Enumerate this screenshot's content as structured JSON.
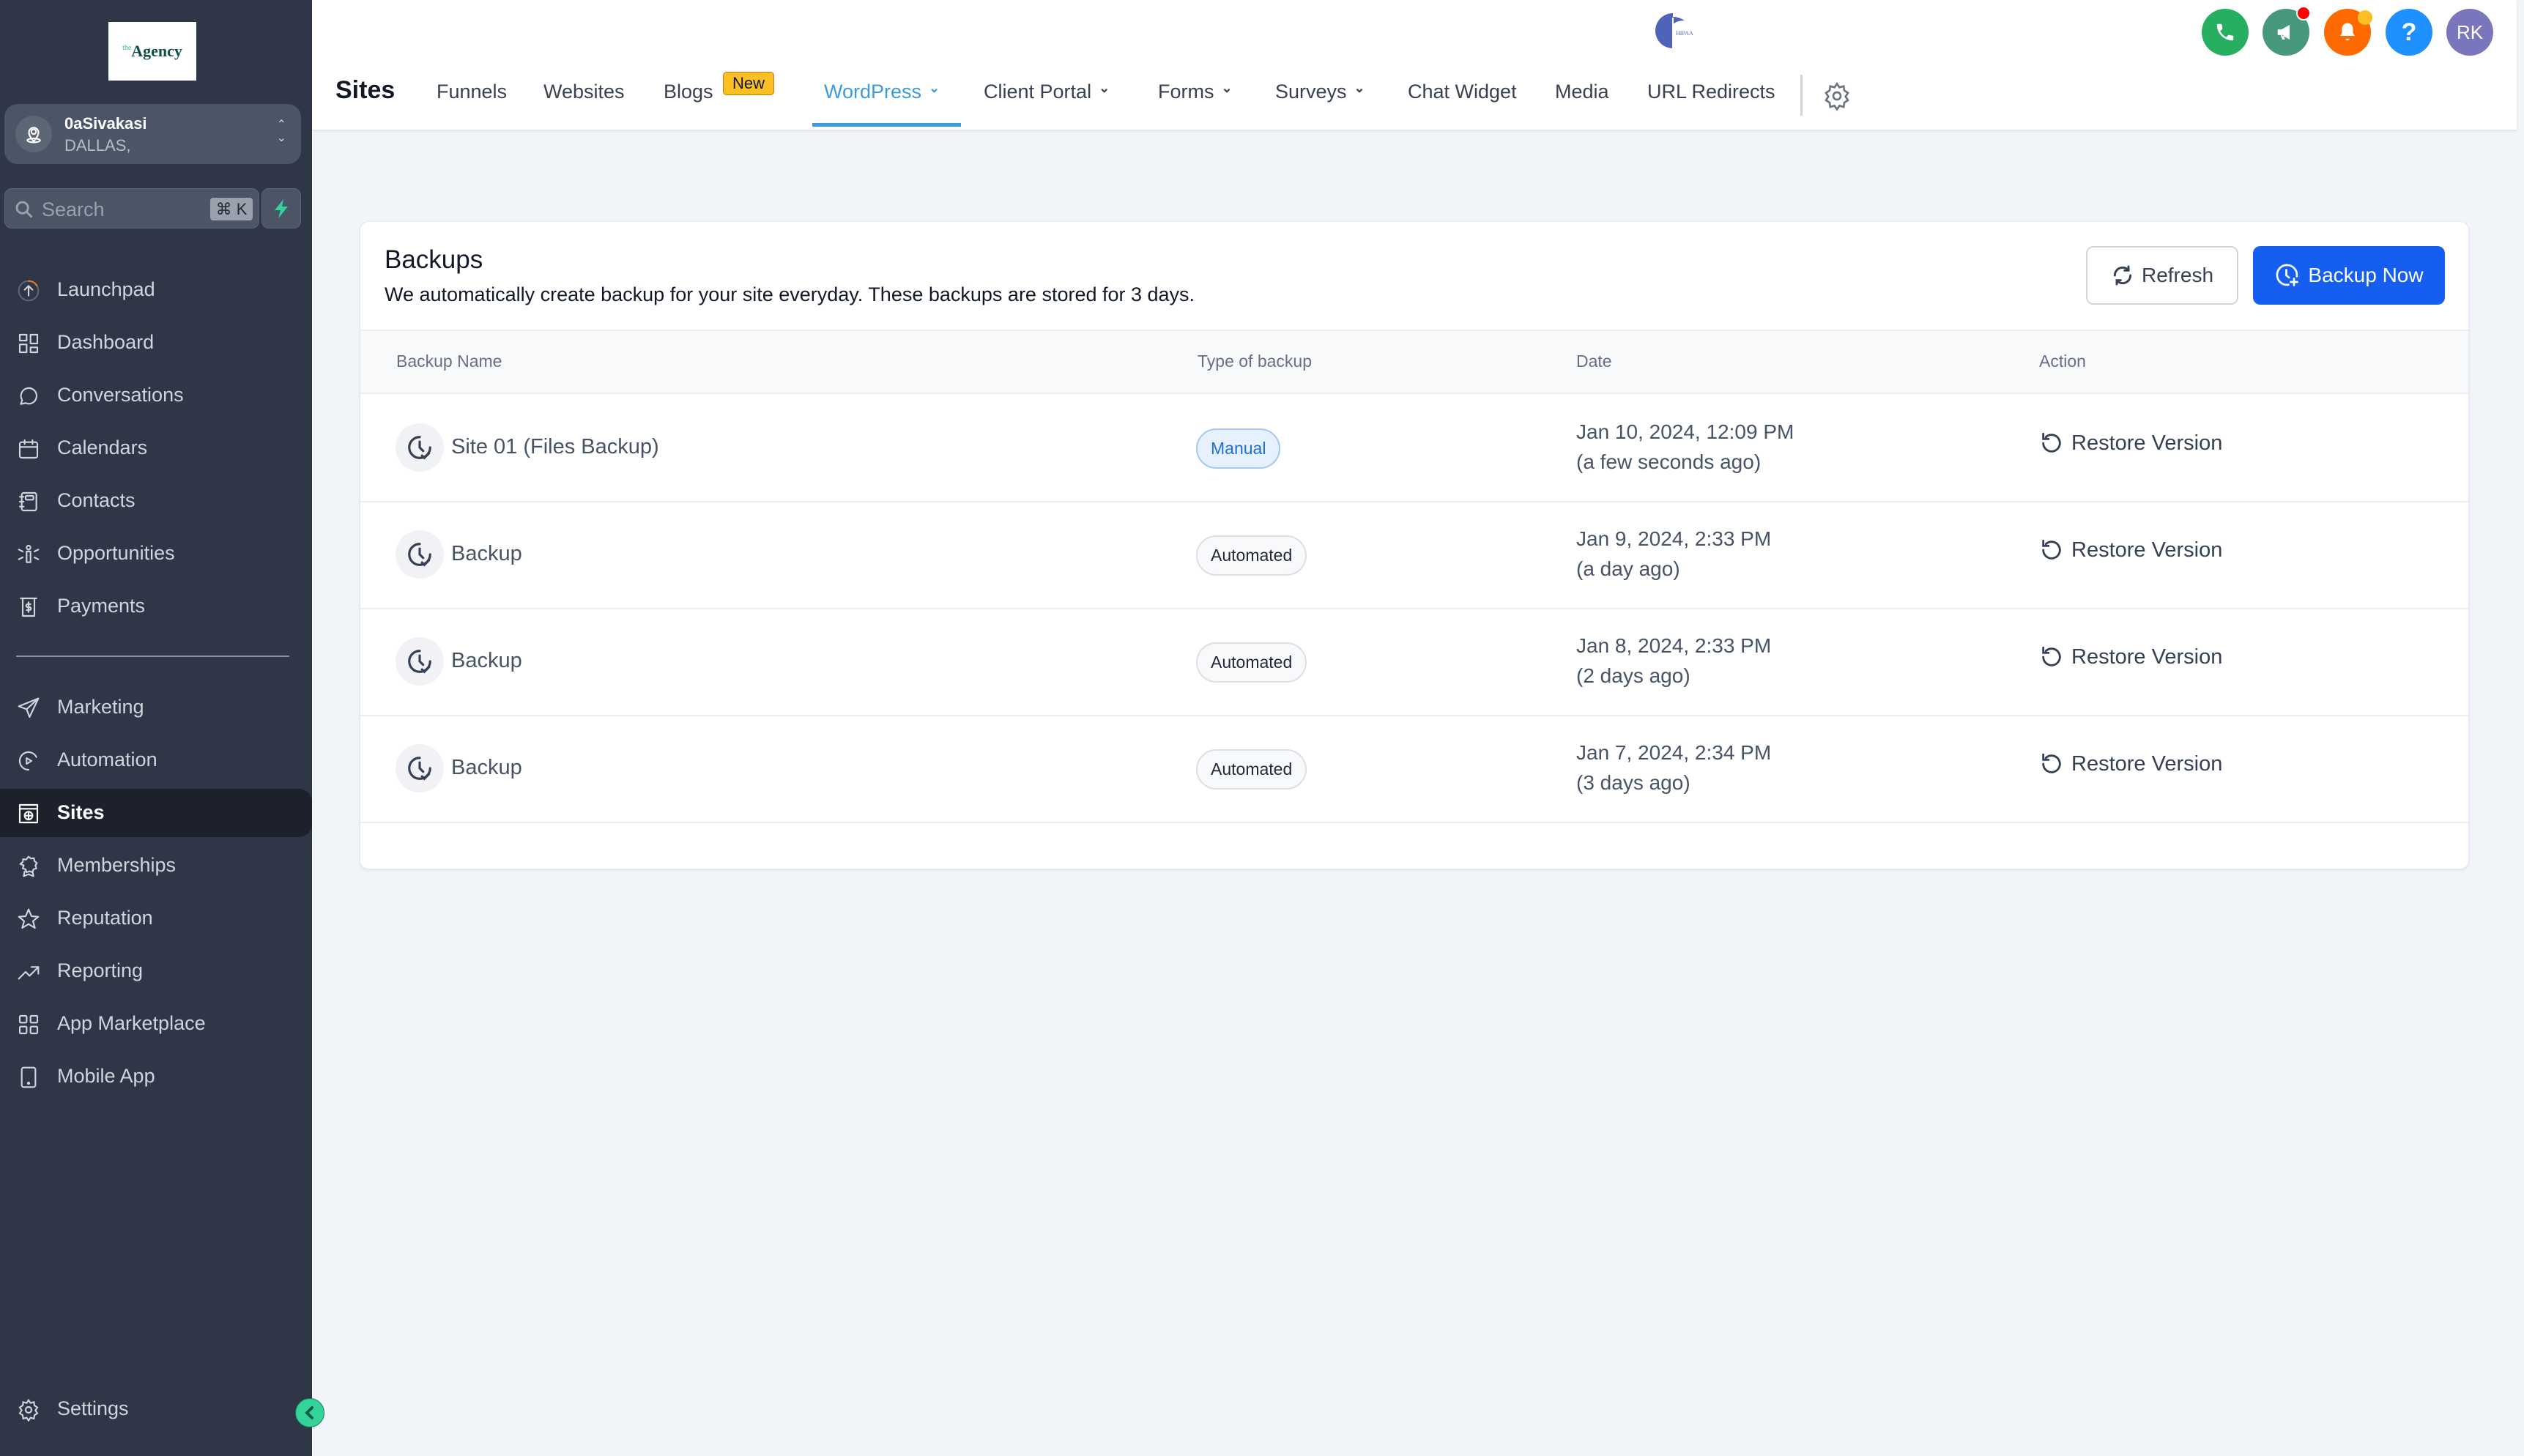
{
  "sidebar": {
    "logo": {
      "small": "the",
      "main": "Agency"
    },
    "location": {
      "name": "0aSivakasi",
      "sub": "DALLAS,"
    },
    "search": {
      "placeholder": "Search",
      "shortcut": "⌘ K"
    },
    "items": [
      {
        "label": "Launchpad",
        "icon": "launchpad-icon"
      },
      {
        "label": "Dashboard",
        "icon": "dashboard-icon"
      },
      {
        "label": "Conversations",
        "icon": "chat-bubble-icon"
      },
      {
        "label": "Calendars",
        "icon": "calendar-icon"
      },
      {
        "label": "Contacts",
        "icon": "contacts-book-icon"
      },
      {
        "label": "Opportunities",
        "icon": "opportunities-icon"
      },
      {
        "label": "Payments",
        "icon": "payments-icon"
      },
      {
        "label": "Marketing",
        "icon": "paper-plane-icon"
      },
      {
        "label": "Automation",
        "icon": "automation-play-icon"
      },
      {
        "label": "Sites",
        "icon": "sites-globe-icon",
        "active": true
      },
      {
        "label": "Memberships",
        "icon": "award-badge-icon"
      },
      {
        "label": "Reputation",
        "icon": "star-icon"
      },
      {
        "label": "Reporting",
        "icon": "trend-up-icon"
      },
      {
        "label": "App Marketplace",
        "icon": "apps-grid-icon"
      },
      {
        "label": "Mobile App",
        "icon": "mobile-phone-icon"
      }
    ],
    "settings": {
      "label": "Settings",
      "icon": "gear-icon"
    }
  },
  "header": {
    "title": "Sites",
    "tabs": [
      {
        "label": "Funnels"
      },
      {
        "label": "Websites"
      },
      {
        "label": "Blogs",
        "badge": "New"
      },
      {
        "label": "WordPress",
        "dropdown": true,
        "active": true
      },
      {
        "label": "Client Portal",
        "dropdown": true
      },
      {
        "label": "Forms",
        "dropdown": true
      },
      {
        "label": "Surveys",
        "dropdown": true
      },
      {
        "label": "Chat Widget"
      },
      {
        "label": "Media"
      },
      {
        "label": "URL Redirects"
      }
    ],
    "logo_text": "HIPAA",
    "actions": {
      "phone_color": "#26af61",
      "announce_color": "#48977f",
      "bell_color": "#ff6a00",
      "help_color": "#1e90ff",
      "avatar_initials": "RK",
      "avatar_color": "#7a76bd"
    }
  },
  "backups": {
    "title": "Backups",
    "description": "We automatically create backup for your site everyday. These backups are stored for 3 days.",
    "refresh_label": "Refresh",
    "backup_now_label": "Backup Now",
    "columns": [
      "Backup Name",
      "Type of backup",
      "Date",
      "Action"
    ],
    "rows": [
      {
        "name": "Site 01 (Files Backup)",
        "type": "Manual",
        "date": "Jan 10, 2024, 12:09 PM",
        "ago": "(a few seconds ago)",
        "action": "Restore Version"
      },
      {
        "name": "Backup",
        "type": "Automated",
        "date": "Jan 9, 2024, 2:33 PM",
        "ago": "(a day ago)",
        "action": "Restore Version"
      },
      {
        "name": "Backup",
        "type": "Automated",
        "date": "Jan 8, 2024, 2:33 PM",
        "ago": "(2 days ago)",
        "action": "Restore Version"
      },
      {
        "name": "Backup",
        "type": "Automated",
        "date": "Jan 7, 2024, 2:34 PM",
        "ago": "(3 days ago)",
        "action": "Restore Version"
      }
    ]
  }
}
